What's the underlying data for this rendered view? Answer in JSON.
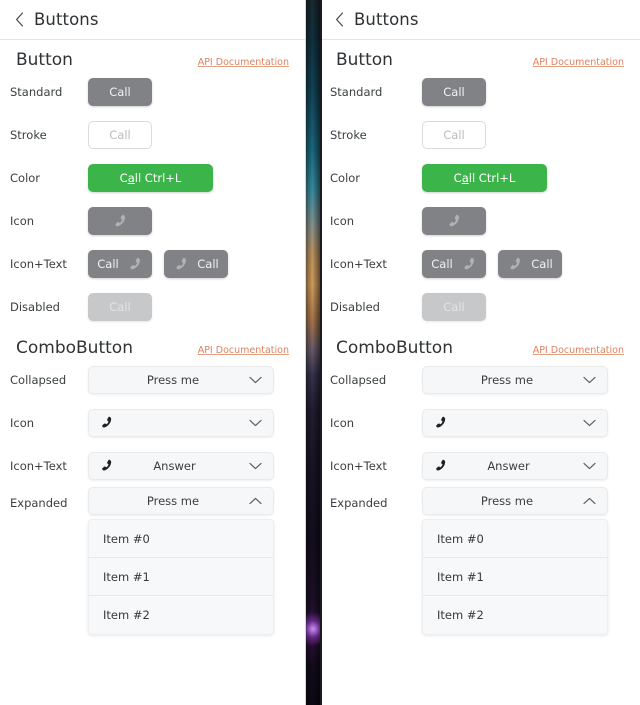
{
  "windows": [
    {
      "id": "left",
      "titlebar": {
        "title": "Buttons",
        "back_icon": "chevron-left-icon"
      },
      "sections": [
        {
          "id": "button",
          "title": "Button",
          "api_link": "API Documentation",
          "rows": [
            {
              "label": "Standard",
              "kind": "standard",
              "buttons": [
                {
                  "text": "Call",
                  "style": "standard"
                }
              ]
            },
            {
              "label": "Stroke",
              "kind": "stroke",
              "buttons": [
                {
                  "text": "Call",
                  "style": "stroke"
                }
              ]
            },
            {
              "label": "Color",
              "kind": "color",
              "buttons": [
                {
                  "text": "Call Ctrl+L",
                  "mnemonic": "a",
                  "style": "color"
                }
              ]
            },
            {
              "label": "Icon",
              "kind": "icon",
              "buttons": [
                {
                  "text": "",
                  "icon": "phone-icon",
                  "style": "icon"
                }
              ]
            },
            {
              "label": "Icon+Text",
              "kind": "icontext",
              "buttons": [
                {
                  "text": "Call",
                  "icon": "phone-icon",
                  "icon_side": "right",
                  "style": "icontext"
                },
                {
                  "text": "Call",
                  "icon": "phone-icon",
                  "icon_side": "left",
                  "style": "icontext"
                }
              ]
            },
            {
              "label": "Disabled",
              "kind": "disabled",
              "buttons": [
                {
                  "text": "Call",
                  "style": "disabled"
                }
              ]
            }
          ]
        },
        {
          "id": "combobutton",
          "title": "ComboButton",
          "api_link": "API Documentation",
          "rows": [
            {
              "label": "Collapsed",
              "text": "Press me",
              "icon": "",
              "caret": "chevron-down-icon",
              "expanded": false
            },
            {
              "label": "Icon",
              "text": "",
              "icon": "phone-icon",
              "caret": "chevron-down-icon",
              "expanded": false
            },
            {
              "label": "Icon+Text",
              "text": "Answer",
              "icon": "phone-icon",
              "caret": "chevron-down-icon",
              "expanded": false
            },
            {
              "label": "Expanded",
              "text": "Press me",
              "icon": "",
              "caret": "chevron-up-icon",
              "expanded": true,
              "items": [
                "Item #0",
                "Item #1",
                "Item #2"
              ]
            }
          ]
        }
      ]
    },
    {
      "id": "right",
      "titlebar": {
        "title": "Buttons",
        "back_icon": "chevron-left-icon"
      },
      "sections": [
        {
          "id": "button",
          "title": "Button",
          "api_link": "API Documentation",
          "rows": [
            {
              "label": "Standard",
              "kind": "standard",
              "buttons": [
                {
                  "text": "Call",
                  "style": "standard"
                }
              ]
            },
            {
              "label": "Stroke",
              "kind": "stroke",
              "buttons": [
                {
                  "text": "Call",
                  "style": "stroke"
                }
              ]
            },
            {
              "label": "Color",
              "kind": "color",
              "buttons": [
                {
                  "text": "Call Ctrl+L",
                  "mnemonic": "a",
                  "style": "color"
                }
              ]
            },
            {
              "label": "Icon",
              "kind": "icon",
              "buttons": [
                {
                  "text": "",
                  "icon": "phone-icon",
                  "style": "icon"
                }
              ]
            },
            {
              "label": "Icon+Text",
              "kind": "icontext",
              "buttons": [
                {
                  "text": "Call",
                  "icon": "phone-icon",
                  "icon_side": "right",
                  "style": "icontext"
                },
                {
                  "text": "Call",
                  "icon": "phone-icon",
                  "icon_side": "left",
                  "style": "icontext"
                }
              ]
            },
            {
              "label": "Disabled",
              "kind": "disabled",
              "buttons": [
                {
                  "text": "Call",
                  "style": "disabled"
                }
              ]
            }
          ]
        },
        {
          "id": "combobutton",
          "title": "ComboButton",
          "api_link": "API Documentation",
          "rows": [
            {
              "label": "Collapsed",
              "text": "Press me",
              "icon": "",
              "caret": "chevron-down-icon",
              "expanded": false
            },
            {
              "label": "Icon",
              "text": "",
              "icon": "phone-icon",
              "caret": "chevron-down-icon",
              "expanded": false
            },
            {
              "label": "Icon+Text",
              "text": "Answer",
              "icon": "phone-icon",
              "caret": "chevron-down-icon",
              "expanded": false
            },
            {
              "label": "Expanded",
              "text": "Press me",
              "icon": "",
              "caret": "chevron-up-icon",
              "expanded": true,
              "items": [
                "Item #0",
                "Item #1",
                "Item #2"
              ]
            }
          ]
        }
      ]
    }
  ],
  "colors": {
    "accent_green": "#3bb54a",
    "button_gray": "#808285",
    "disabled_gray": "#c6c8ca",
    "api_link": "#e08060",
    "text": "#3a3f42"
  }
}
